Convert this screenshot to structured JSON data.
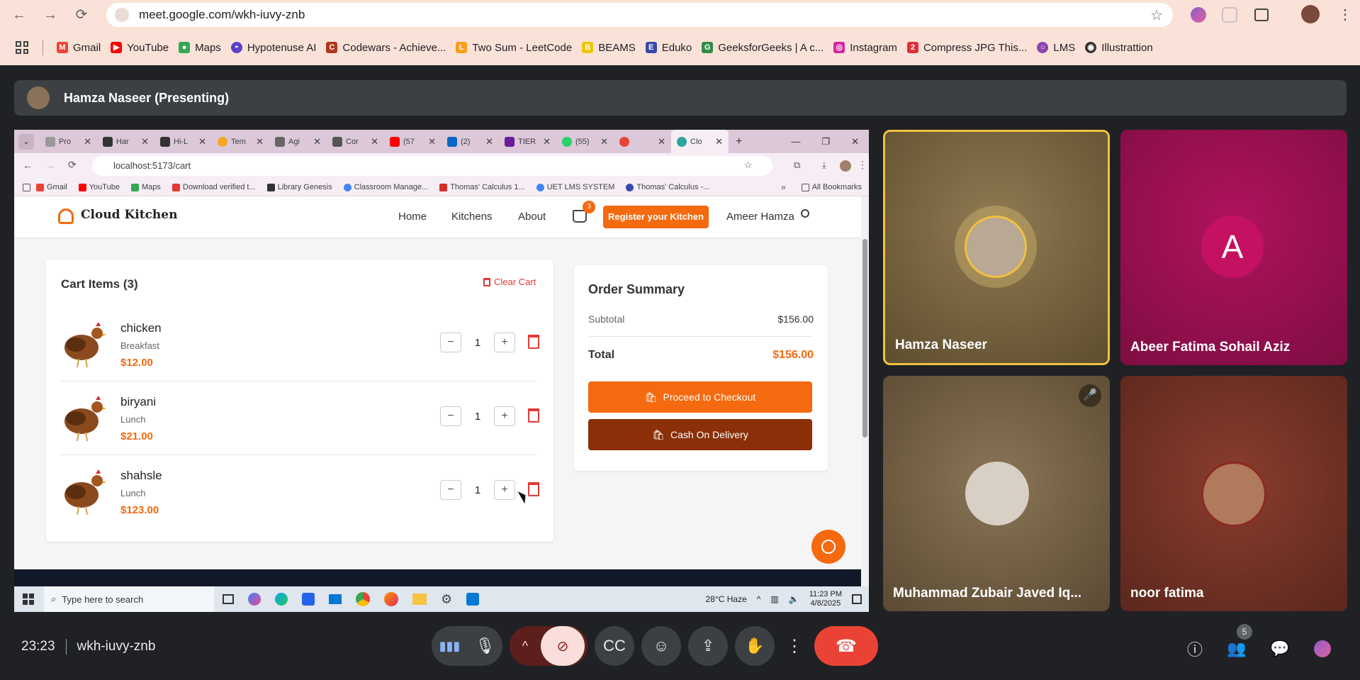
{
  "browser": {
    "url": "meet.google.com/wkh-iuvy-znb",
    "bookmarks": [
      "Gmail",
      "YouTube",
      "Maps",
      "Hypotenuse AI",
      "Codewars - Achieve...",
      "Two Sum - LeetCode",
      "BEAMS",
      "Eduko",
      "GeeksforGeeks | A c...",
      "Instagram",
      "Compress JPG This...",
      "LMS",
      "Illustrattion"
    ]
  },
  "presenter": {
    "label": "Hamza Naseer (Presenting)"
  },
  "shared": {
    "tabs": [
      "Pro",
      "Har",
      "Hi-L",
      "Tem",
      "Agi",
      "Cor",
      "(57",
      "(2)",
      "TIER",
      "(55)",
      "",
      "Clo"
    ],
    "url": "localhost:5173/cart",
    "bookmarks": [
      "Gmail",
      "YouTube",
      "Maps",
      "Download verified t...",
      "Library Genesis",
      "Classroom Manage...",
      "Thomas' Calculus 1...",
      "UET LMS SYSTEM",
      "Thomas' Calculus -..."
    ],
    "all_bookmarks": "All Bookmarks",
    "site": {
      "brand": "Cloud Kitchen",
      "nav": [
        "Home",
        "Kitchens",
        "About"
      ],
      "cart_count": "3",
      "register": "Register your Kitchen",
      "user": "Ameer Hamza",
      "cart_title": "Cart Items (3)",
      "clear_cart": "Clear Cart",
      "items": [
        {
          "name": "chicken",
          "category": "Breakfast",
          "price": "$12.00",
          "qty": "1"
        },
        {
          "name": "biryani",
          "category": "Lunch",
          "price": "$21.00",
          "qty": "1"
        },
        {
          "name": "shahsle",
          "category": "Lunch",
          "price": "$123.00",
          "qty": "1"
        }
      ],
      "summary_title": "Order Summary",
      "subtotal_label": "Subtotal",
      "subtotal": "$156.00",
      "total_label": "Total",
      "total": "$156.00",
      "checkout": "Proceed to Checkout",
      "cod": "Cash On Delivery"
    },
    "taskbar": {
      "search": "Type here to search",
      "weather": "28°C  Haze",
      "time": "11:23 PM",
      "date": "4/8/2025"
    }
  },
  "participants": [
    {
      "name": "Hamza Naseer",
      "bg": "#6b5a38"
    },
    {
      "name": "Abeer Fatima Sohail Aziz",
      "initial": "A",
      "bg": "#9c1150"
    },
    {
      "name": "Muhammad Zubair Javed Iq...",
      "bg": "#6e5a40"
    },
    {
      "name": "noor fatima",
      "bg": "#6b2f24"
    }
  ],
  "meeting": {
    "time": "23:23",
    "code": "wkh-iuvy-znb",
    "people_count": "5"
  },
  "colors": {
    "accent": "#f5690f",
    "cod": "#8a2f08",
    "end_call": "#ea4335"
  }
}
